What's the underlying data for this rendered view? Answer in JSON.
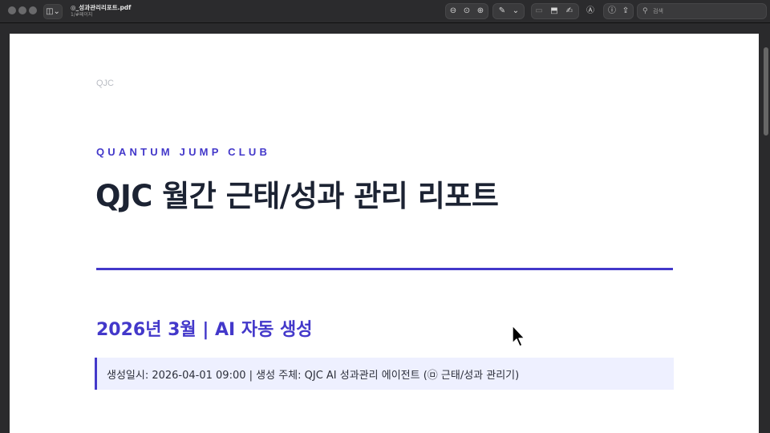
{
  "window": {
    "title": "◎_성과관리리포트.pdf",
    "subtitle": "1/#페이지"
  },
  "toolbar": {
    "search_placeholder": "검색",
    "icons": [
      "sidebar-icon",
      "zoom-out-icon",
      "zoom-fit-icon",
      "zoom-in-icon",
      "markup-pen-icon",
      "crop-icon",
      "rotate-icon",
      "sign-icon",
      "annotate-icon",
      "info-icon",
      "share-icon",
      "search-icon"
    ]
  },
  "document": {
    "running_header": "QJC",
    "eyebrow": "QUANTUM JUMP CLUB",
    "title": "QJC 월간 근태/성과 관리 리포트",
    "subtitle": "2026년 3월 | AI 자동 생성",
    "callout": "생성일시: 2026-04-01 09:00 | 생성 주체: QJC AI 성과관리 에이전트 (㉤ 근태/성과 관리기)"
  },
  "colors": {
    "accent": "#4338ca",
    "title": "#1c2333",
    "callout_bg": "#eef0ff"
  }
}
